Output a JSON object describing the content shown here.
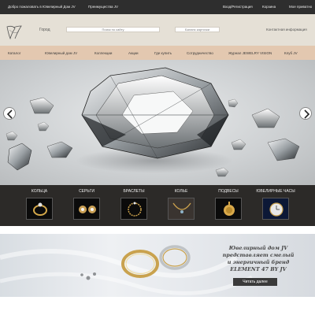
{
  "topbar": {
    "welcome": "Добро пожаловать в Ювелирный Дом JV",
    "advantages": "Преимущества JV",
    "login": "Вход/Регистрация",
    "cart": "Корзина",
    "favorites": "Мое приватно"
  },
  "header": {
    "city": "Город",
    "search_placeholder": "Поиск по сайту",
    "card_placeholder": "Баланс карточки",
    "contact": "Контактная информация"
  },
  "nav": {
    "items": [
      "Каталог",
      "Ювелирный дом JV",
      "Коллекции",
      "Акции",
      "Где купить",
      "Сотрудничество",
      "Журнал JEWELRY VISION",
      "Клуб JV"
    ]
  },
  "categories": [
    {
      "label": "КОЛЬЦА",
      "icon": "ring-icon"
    },
    {
      "label": "СЕРЬГИ",
      "icon": "earrings-icon"
    },
    {
      "label": "БРАСЛЕТЫ",
      "icon": "bracelet-icon"
    },
    {
      "label": "КОЛЬЕ",
      "icon": "necklace-icon"
    },
    {
      "label": "ПОДВЕСЫ",
      "icon": "pendant-icon"
    },
    {
      "label": "ЮВЕЛИРНЫЕ ЧАСЫ",
      "icon": "watch-icon"
    }
  ],
  "promo": {
    "line1": "Ювелирный дом JV",
    "line2": "представляет смелый",
    "line3": "и энергичный бренд",
    "line4": "ELEMENT 47 BY JV",
    "button": "Читать далее"
  },
  "colors": {
    "topbar": "#2e2e2e",
    "header": "#e5e0d6",
    "nav": "#e3c8b0",
    "categories_bg": "#2c2a28"
  }
}
